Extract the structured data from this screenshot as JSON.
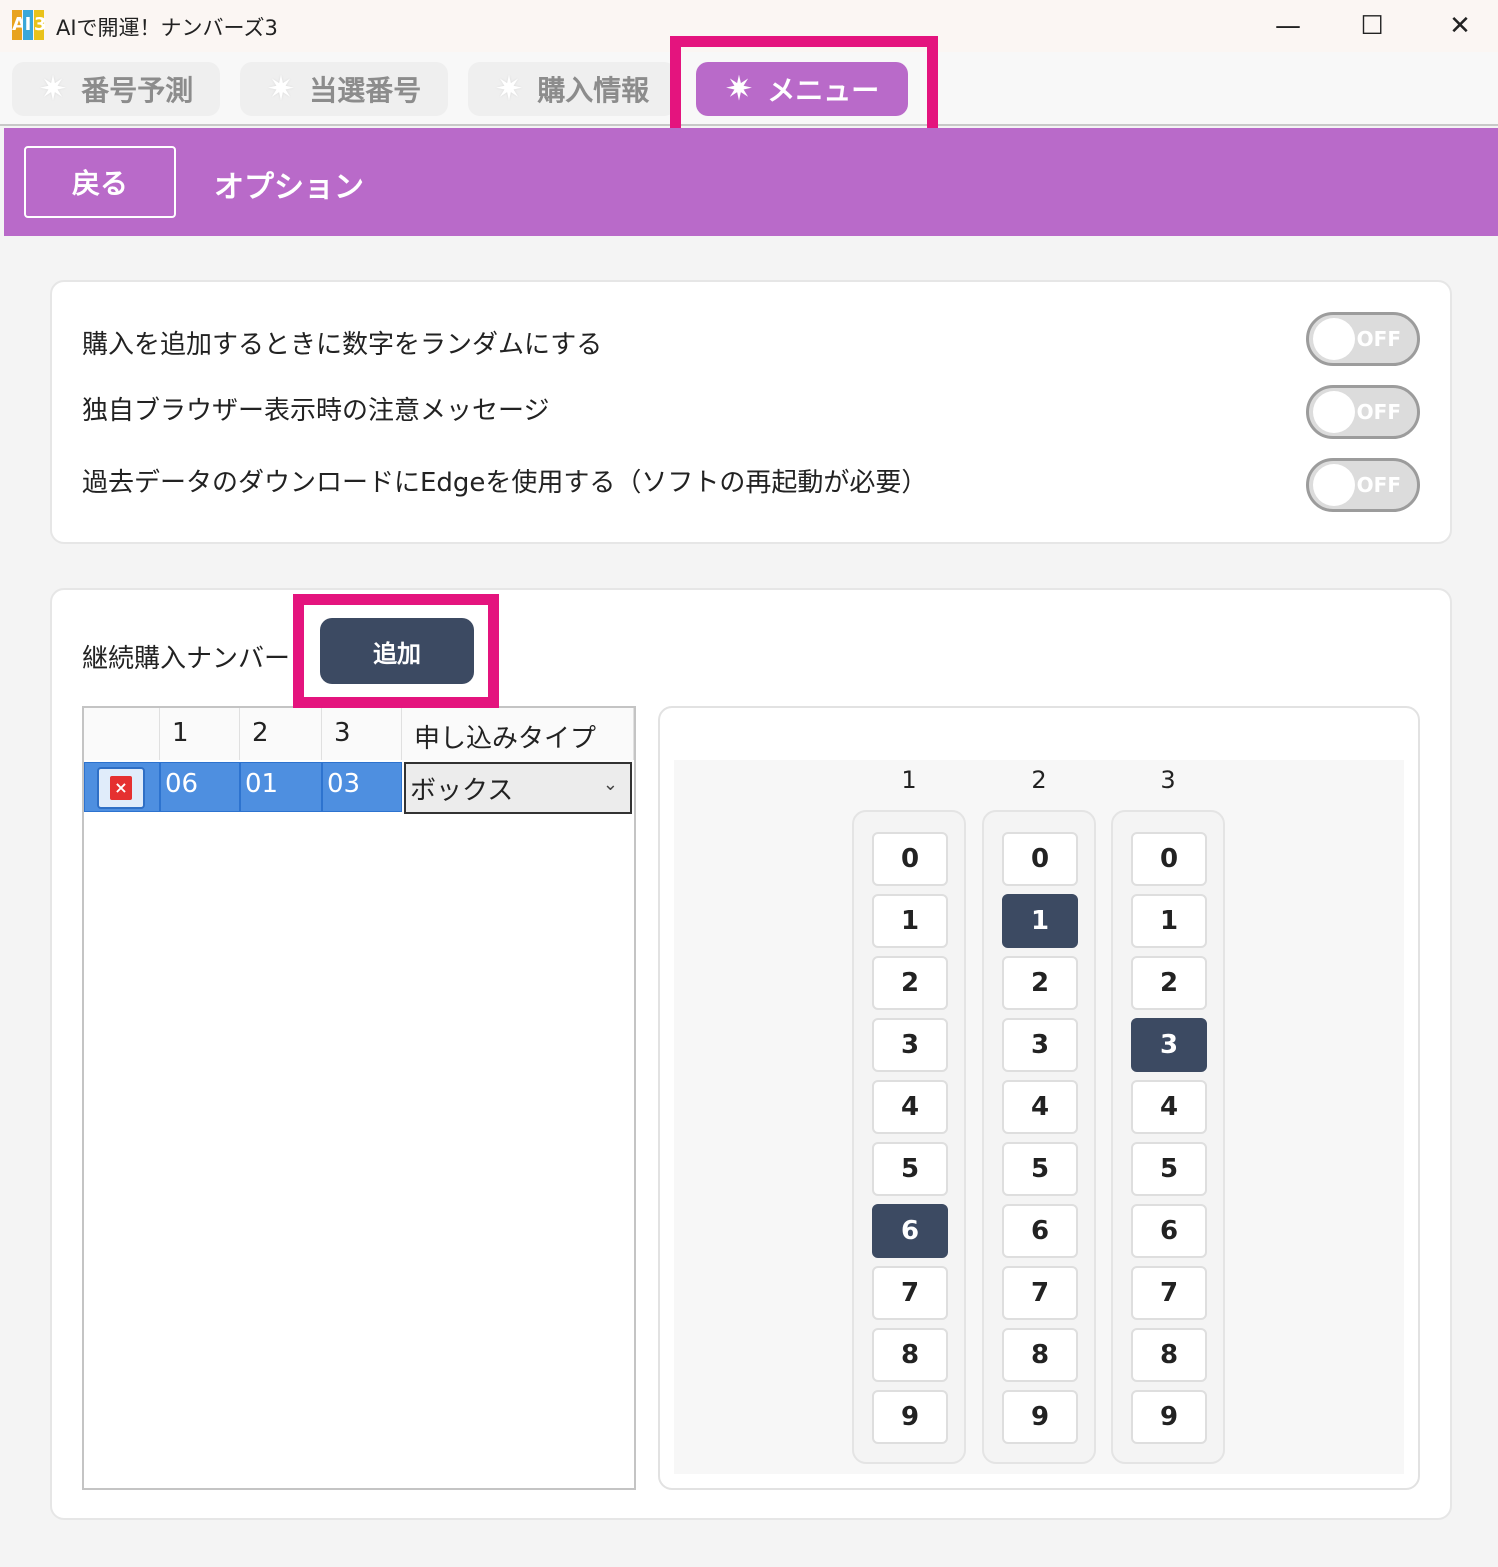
{
  "window": {
    "title": "AIで開運！ナンバーズ3",
    "minimize_glyph": "—",
    "maximize_glyph": "☐",
    "close_glyph": "✕",
    "logo": {
      "letters": "AI3",
      "colors": [
        "#e8a31f",
        "#3aa7d9",
        "#e9c21a"
      ]
    }
  },
  "tabs": [
    {
      "label": "番号予測",
      "icon": "sparkle-icon",
      "active": false
    },
    {
      "label": "当選番号",
      "icon": "sparkle-icon",
      "active": false
    },
    {
      "label": "購入情報",
      "icon": "sparkle-icon",
      "active": false
    },
    {
      "label": "メニュー",
      "icon": "sparkle-icon",
      "active": true
    }
  ],
  "header": {
    "back_label": "戻る",
    "title": "オプション"
  },
  "settings": [
    {
      "label": "購入を追加するときに数字をランダムにする",
      "state": "OFF"
    },
    {
      "label": "独自ブラウザー表示時の注意メッセージ",
      "state": "OFF"
    },
    {
      "label": "過去データのダウンロードにEdgeを使用する（ソフトの再起動が必要）",
      "state": "OFF"
    }
  ],
  "continuous": {
    "label": "継続購入ナンバー",
    "add_label": "追加",
    "columns": [
      "1",
      "2",
      "3",
      "申し込みタイプ"
    ],
    "rows": [
      {
        "n1": "06",
        "n2": "01",
        "n3": "03",
        "type": "ボックス"
      }
    ]
  },
  "picker": {
    "columns": [
      {
        "label": "1",
        "selected": 6
      },
      {
        "label": "2",
        "selected": 1
      },
      {
        "label": "3",
        "selected": 3
      }
    ],
    "digits": [
      "0",
      "1",
      "2",
      "3",
      "4",
      "5",
      "6",
      "7",
      "8",
      "9"
    ]
  },
  "colors": {
    "accent": "#b96ac9",
    "highlight": "#e4147e",
    "selected": "#3c4a62",
    "row_selected": "#4e8fe0"
  }
}
